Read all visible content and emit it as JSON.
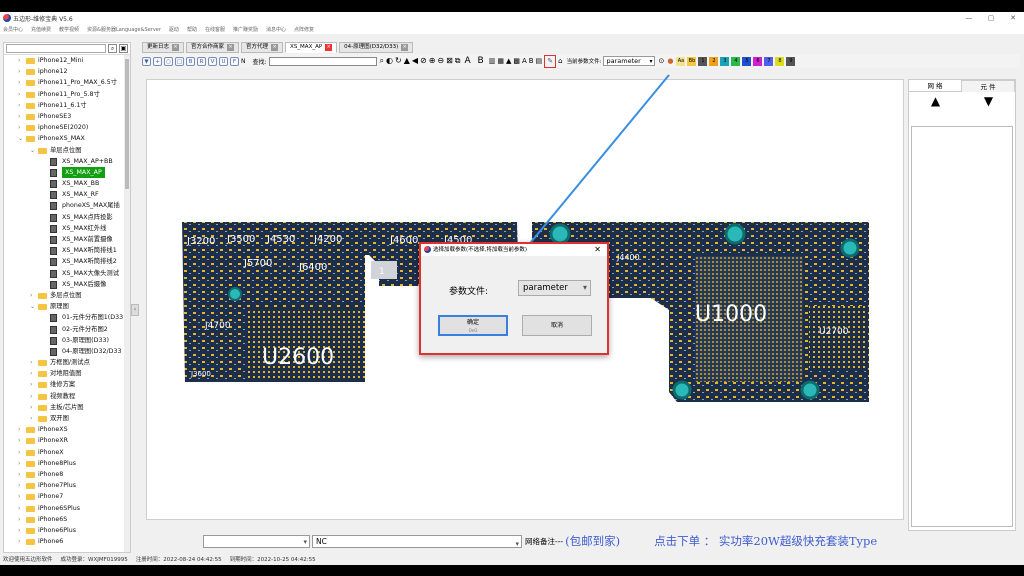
{
  "window": {
    "title": "五边形-维修宝典 V5.6",
    "controls": [
      "—",
      "▢",
      "✕"
    ]
  },
  "menu": [
    "会员中心",
    "充值续费",
    "教学视频",
    "资源&服务器Language&Server",
    "驱动",
    "帮助",
    "在线客服",
    "推广赚奖励",
    "消息中心",
    "点阵修复"
  ],
  "sidebar": {
    "tree": [
      {
        "label": "iPhone12_Mini",
        "type": "folder",
        "level": 1,
        "arrow": "›"
      },
      {
        "label": "iphone12",
        "type": "folder",
        "level": 1,
        "arrow": "›"
      },
      {
        "label": "iPhone11_Pro_MAX_6.5寸",
        "type": "folder",
        "level": 1,
        "arrow": "›"
      },
      {
        "label": "iPhone11_Pro_5.8寸",
        "type": "folder",
        "level": 1,
        "arrow": "›"
      },
      {
        "label": "iPhone11_6.1寸",
        "type": "folder",
        "level": 1,
        "arrow": "›"
      },
      {
        "label": "iPhoneSE3",
        "type": "folder",
        "level": 1,
        "arrow": "›"
      },
      {
        "label": "iphoneSE(2020)",
        "type": "folder",
        "level": 1,
        "arrow": "›"
      },
      {
        "label": "iPhoneXS_MAX",
        "type": "folder",
        "level": 1,
        "arrow": "⌄"
      },
      {
        "label": "单层点位图",
        "type": "folder",
        "level": 2,
        "arrow": "⌄"
      },
      {
        "label": "XS_MAX_AP+BB",
        "type": "file",
        "level": 3,
        "arrow": ""
      },
      {
        "label": "XS_MAX_AP",
        "type": "file",
        "level": 3,
        "arrow": "",
        "selected": true
      },
      {
        "label": "XS_MAX_BB",
        "type": "file",
        "level": 3,
        "arrow": ""
      },
      {
        "label": "XS_MAX_RF",
        "type": "file",
        "level": 3,
        "arrow": ""
      },
      {
        "label": "phoneXS_MAX尾插",
        "type": "file",
        "level": 3,
        "arrow": ""
      },
      {
        "label": "XS_MAX点阵投影",
        "type": "file",
        "level": 3,
        "arrow": ""
      },
      {
        "label": "XS_MAX红外线",
        "type": "file",
        "level": 3,
        "arrow": ""
      },
      {
        "label": "XS_MAX前置摄像",
        "type": "file",
        "level": 3,
        "arrow": ""
      },
      {
        "label": "XS_MAX听筒排线1",
        "type": "file",
        "level": 3,
        "arrow": ""
      },
      {
        "label": "XS_MAX听筒排线2",
        "type": "file",
        "level": 3,
        "arrow": ""
      },
      {
        "label": "XS_MAX大像头测试",
        "type": "file",
        "level": 3,
        "arrow": ""
      },
      {
        "label": "XS_MAX后摄像",
        "type": "file",
        "level": 3,
        "arrow": ""
      },
      {
        "label": "多层点位图",
        "type": "folder",
        "level": 2,
        "arrow": "›"
      },
      {
        "label": "原理图",
        "type": "folder",
        "level": 2,
        "arrow": "⌄"
      },
      {
        "label": "01-元件分布图1(D33",
        "type": "file",
        "level": 3,
        "arrow": ""
      },
      {
        "label": "02-元件分布图2",
        "type": "file",
        "level": 3,
        "arrow": ""
      },
      {
        "label": "03-原理图(D33)",
        "type": "file",
        "level": 3,
        "arrow": ""
      },
      {
        "label": "04-原理图(D32/D33",
        "type": "file",
        "level": 3,
        "arrow": ""
      },
      {
        "label": "方框图/测试点",
        "type": "folder",
        "level": 2,
        "arrow": "›"
      },
      {
        "label": "对地阻值图",
        "type": "folder",
        "level": 2,
        "arrow": "›"
      },
      {
        "label": "维修方案",
        "type": "folder",
        "level": 2,
        "arrow": "›"
      },
      {
        "label": "视频教程",
        "type": "folder",
        "level": 2,
        "arrow": "›"
      },
      {
        "label": "主板/芯片图",
        "type": "folder",
        "level": 2,
        "arrow": "›"
      },
      {
        "label": "双开图",
        "type": "folder",
        "level": 2,
        "arrow": "›"
      },
      {
        "label": "iPhoneXS",
        "type": "folder",
        "level": 1,
        "arrow": "›"
      },
      {
        "label": "iPhoneXR",
        "type": "folder",
        "level": 1,
        "arrow": "›"
      },
      {
        "label": "iPhoneX",
        "type": "folder",
        "level": 1,
        "arrow": "›"
      },
      {
        "label": "iPhone8Plus",
        "type": "folder",
        "level": 1,
        "arrow": "›"
      },
      {
        "label": "iPhone8",
        "type": "folder",
        "level": 1,
        "arrow": "›"
      },
      {
        "label": "iPhone7Plus",
        "type": "folder",
        "level": 1,
        "arrow": "›"
      },
      {
        "label": "iPhone7",
        "type": "folder",
        "level": 1,
        "arrow": "›"
      },
      {
        "label": "iPhone6SPlus",
        "type": "folder",
        "level": 1,
        "arrow": "›"
      },
      {
        "label": "iPhone6S",
        "type": "folder",
        "level": 1,
        "arrow": "›"
      },
      {
        "label": "iPhone6Plus",
        "type": "folder",
        "level": 1,
        "arrow": "›"
      },
      {
        "label": "iPhone6",
        "type": "folder",
        "level": 1,
        "arrow": "›"
      }
    ]
  },
  "tabs": [
    {
      "label": "更新日志",
      "active": false
    },
    {
      "label": "官方合作商家",
      "active": false
    },
    {
      "label": "官方代理",
      "active": false
    },
    {
      "label": "XS_MAX_AP",
      "active": true
    },
    {
      "label": "04-原理图(D32/D33)",
      "active": false
    }
  ],
  "toolbar": {
    "tools": [
      "▼",
      "+",
      "○",
      "□",
      "B",
      "R",
      "V",
      "U",
      "F",
      "N"
    ],
    "search_label": "查找:",
    "search_value": "",
    "param_label": "当前参数文件:",
    "param_value": "parameter",
    "swatches": [
      {
        "label": "Aa",
        "color": "#f4e28a"
      },
      {
        "label": "Bb",
        "color": "#f4c842"
      },
      {
        "label": "1",
        "color": "#555555"
      },
      {
        "label": "2",
        "color": "#f0a020"
      },
      {
        "label": "3",
        "color": "#1aa3b8"
      },
      {
        "label": "4",
        "color": "#2ab84a"
      },
      {
        "label": "5",
        "color": "#2050d0"
      },
      {
        "label": "6",
        "color": "#d020d0"
      },
      {
        "label": "7",
        "color": "#5060e8"
      },
      {
        "label": "8",
        "color": "#dddd20"
      },
      {
        "label": "9",
        "color": "#555555"
      }
    ]
  },
  "board": {
    "labels": [
      "J3200",
      "J3500",
      "J4530",
      "J4200",
      "J4600",
      "J4500",
      "J5700",
      "J6400",
      "J4700",
      "U2600",
      "U1000",
      "J4400",
      "U2700",
      "J3600",
      "1"
    ]
  },
  "right_panel": {
    "tabs": [
      "网 络",
      "元 件"
    ],
    "arrows": [
      "▲",
      "▼"
    ]
  },
  "bottom": {
    "net_value": "NC",
    "note_label": "网络备注---",
    "promo": "(包邮到家)",
    "promo2": "点击下单 ： 实功率20W超级快充套装Type"
  },
  "status": {
    "welcome": "欢迎使用五边形软件",
    "login": "成功登录：WXJMF019995",
    "register": "注册时间：2022-08-24 04:42:55",
    "expire": "到期时间：2022-10-25 04:42:55"
  },
  "dialog": {
    "title": "选择加载参数(不选择,将加载当前参数)",
    "close": "✕",
    "param_label": "参数文件:",
    "param_value": "parameter",
    "ok_label": "确定",
    "ok_sub": "OnO",
    "cancel_label": "取消"
  },
  "colors": {
    "board": "#1c2e4a",
    "pad": "#e6b52c",
    "highlight": "#e03030",
    "arrow": "#3a8de0",
    "promo": "#3e5ccf",
    "selected": "#12a012"
  }
}
